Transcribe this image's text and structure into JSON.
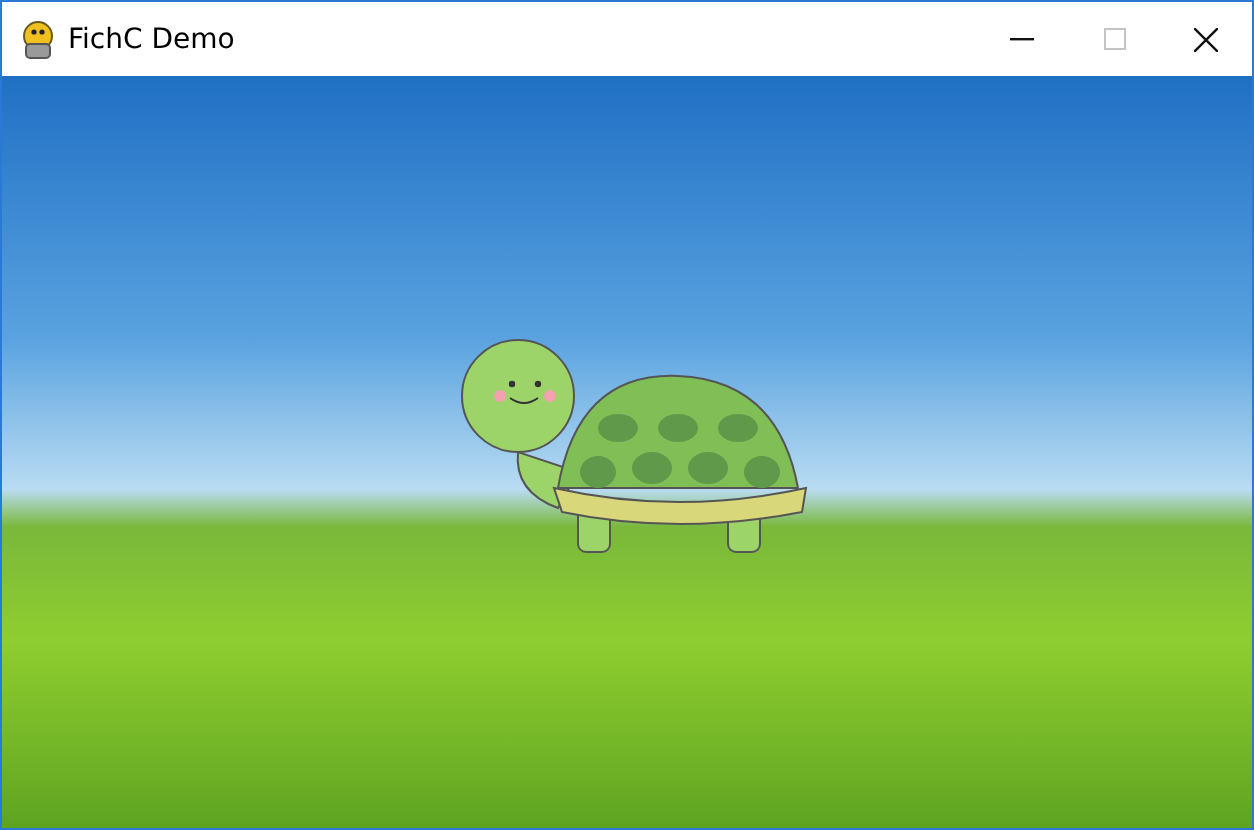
{
  "window": {
    "title": "FichC Demo",
    "controls": [
      {
        "kind": "minimize",
        "disabled": false
      },
      {
        "kind": "maximize",
        "disabled": true
      },
      {
        "kind": "close",
        "disabled": false
      }
    ]
  }
}
